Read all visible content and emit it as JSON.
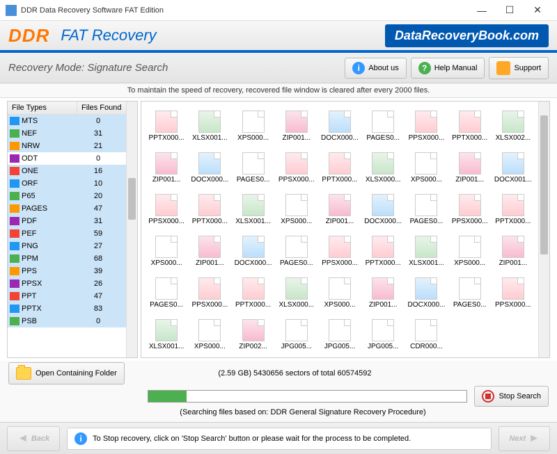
{
  "titlebar": {
    "title": "DDR Data Recovery Software FAT Edition"
  },
  "header": {
    "logo": "DDR",
    "product": "FAT Recovery",
    "brand": "DataRecoveryBook.com"
  },
  "toolbar": {
    "mode": "Recovery Mode: Signature Search",
    "about": "About us",
    "help": "Help Manual",
    "support": "Support"
  },
  "note": "To maintain the speed of recovery, recovered file window is cleared after every 2000 files.",
  "leftHeader": {
    "c1": "File Types",
    "c2": "Files Found"
  },
  "types": [
    {
      "ext": "MTS",
      "count": 0,
      "sel": true
    },
    {
      "ext": "NEF",
      "count": 31,
      "sel": true
    },
    {
      "ext": "NRW",
      "count": 21,
      "sel": true
    },
    {
      "ext": "ODT",
      "count": 0,
      "sel": false
    },
    {
      "ext": "ONE",
      "count": 16,
      "sel": true
    },
    {
      "ext": "ORF",
      "count": 10,
      "sel": true
    },
    {
      "ext": "P65",
      "count": 20,
      "sel": true
    },
    {
      "ext": "PAGES",
      "count": 47,
      "sel": true
    },
    {
      "ext": "PDF",
      "count": 31,
      "sel": true
    },
    {
      "ext": "PEF",
      "count": 59,
      "sel": true
    },
    {
      "ext": "PNG",
      "count": 27,
      "sel": true
    },
    {
      "ext": "PPM",
      "count": 68,
      "sel": true
    },
    {
      "ext": "PPS",
      "count": 39,
      "sel": true
    },
    {
      "ext": "PPSX",
      "count": 26,
      "sel": true
    },
    {
      "ext": "PPT",
      "count": 47,
      "sel": true
    },
    {
      "ext": "PPTX",
      "count": 83,
      "sel": true
    },
    {
      "ext": "PSB",
      "count": 0,
      "sel": true
    }
  ],
  "files": [
    {
      "n": "PPTX000...",
      "t": "ppt"
    },
    {
      "n": "XLSX001...",
      "t": "xls"
    },
    {
      "n": "XPS000...",
      "t": "blank"
    },
    {
      "n": "ZIP001...",
      "t": "zip"
    },
    {
      "n": "DOCX000...",
      "t": "doc"
    },
    {
      "n": "PAGES0...",
      "t": "blank"
    },
    {
      "n": "PPSX000...",
      "t": "ppt"
    },
    {
      "n": "PPTX000...",
      "t": "ppt"
    },
    {
      "n": "XLSX002...",
      "t": "xls"
    },
    {
      "n": "ZIP001...",
      "t": "zip"
    },
    {
      "n": "DOCX000...",
      "t": "doc"
    },
    {
      "n": "PAGES0...",
      "t": "blank"
    },
    {
      "n": "PPSX000...",
      "t": "ppt"
    },
    {
      "n": "PPTX000...",
      "t": "ppt"
    },
    {
      "n": "XLSX000...",
      "t": "xls"
    },
    {
      "n": "XPS000...",
      "t": "blank"
    },
    {
      "n": "ZIP001...",
      "t": "zip"
    },
    {
      "n": "DOCX001...",
      "t": "doc"
    },
    {
      "n": "PPSX000...",
      "t": "ppt"
    },
    {
      "n": "PPTX000...",
      "t": "ppt"
    },
    {
      "n": "XLSX001...",
      "t": "xls"
    },
    {
      "n": "XPS000...",
      "t": "blank"
    },
    {
      "n": "ZIP001...",
      "t": "zip"
    },
    {
      "n": "DOCX000...",
      "t": "doc"
    },
    {
      "n": "PAGES0...",
      "t": "blank"
    },
    {
      "n": "PPSX000...",
      "t": "ppt"
    },
    {
      "n": "PPTX000...",
      "t": "ppt"
    },
    {
      "n": "XPS000...",
      "t": "blank"
    },
    {
      "n": "ZIP001...",
      "t": "zip"
    },
    {
      "n": "DOCX000...",
      "t": "doc"
    },
    {
      "n": "PAGES0...",
      "t": "blank"
    },
    {
      "n": "PPSX000...",
      "t": "ppt"
    },
    {
      "n": "PPTX000...",
      "t": "ppt"
    },
    {
      "n": "XLSX001...",
      "t": "xls"
    },
    {
      "n": "XPS000...",
      "t": "blank"
    },
    {
      "n": "ZIP001...",
      "t": "zip"
    },
    {
      "n": "PAGES0...",
      "t": "blank"
    },
    {
      "n": "PPSX000...",
      "t": "ppt"
    },
    {
      "n": "PPTX000...",
      "t": "ppt"
    },
    {
      "n": "XLSX000...",
      "t": "xls"
    },
    {
      "n": "XPS000...",
      "t": "blank"
    },
    {
      "n": "ZIP001...",
      "t": "zip"
    },
    {
      "n": "DOCX000...",
      "t": "doc"
    },
    {
      "n": "PAGES0...",
      "t": "blank"
    },
    {
      "n": "PPSX000...",
      "t": "ppt"
    },
    {
      "n": "XLSX001...",
      "t": "xls"
    },
    {
      "n": "XPS000...",
      "t": "blank"
    },
    {
      "n": "ZIP002...",
      "t": "zip"
    },
    {
      "n": "JPG005...",
      "t": "blank"
    },
    {
      "n": "JPG005...",
      "t": "blank"
    },
    {
      "n": "JPG005...",
      "t": "blank"
    },
    {
      "n": "CDR000...",
      "t": "blank"
    }
  ],
  "progress": {
    "open": "Open Containing Folder",
    "text": "(2.59 GB) 5430656  sectors  of  total 60574592",
    "sub": "(Searching files based on:  DDR General Signature Recovery Procedure)",
    "stop": "Stop Search"
  },
  "footer": {
    "back": "Back",
    "next": "Next",
    "msg": "To Stop recovery, click on 'Stop Search' button or please wait for the process to be completed."
  }
}
